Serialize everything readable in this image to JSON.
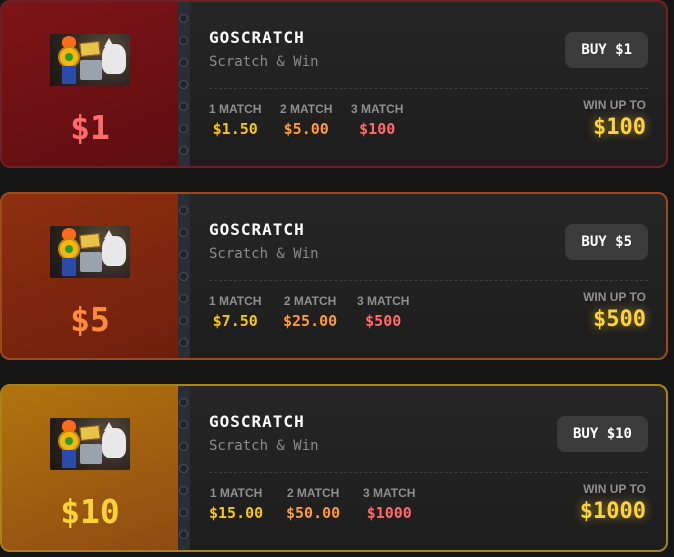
{
  "tickets": [
    {
      "price": "$1",
      "title": "GOSCRATCH",
      "subtitle": "Scratch & Win",
      "buy_label": "BUY $1",
      "matches": [
        {
          "label": "1 MATCH",
          "value": "$1.50"
        },
        {
          "label": "2 MATCH",
          "value": "$5.00"
        },
        {
          "label": "3 MATCH",
          "value": "$100"
        }
      ],
      "win_label": "WIN UP TO",
      "win_value": "$100"
    },
    {
      "price": "$5",
      "title": "GOSCRATCH",
      "subtitle": "Scratch & Win",
      "buy_label": "BUY $5",
      "matches": [
        {
          "label": "1 MATCH",
          "value": "$7.50"
        },
        {
          "label": "2 MATCH",
          "value": "$25.00"
        },
        {
          "label": "3 MATCH",
          "value": "$500"
        }
      ],
      "win_label": "WIN UP TO",
      "win_value": "$500"
    },
    {
      "price": "$10",
      "title": "GOSCRATCH",
      "subtitle": "Scratch & Win",
      "buy_label": "BUY $10",
      "matches": [
        {
          "label": "1 MATCH",
          "value": "$15.00"
        },
        {
          "label": "2 MATCH",
          "value": "$50.00"
        },
        {
          "label": "3 MATCH",
          "value": "$1000"
        }
      ],
      "win_label": "WIN UP TO",
      "win_value": "$1000"
    }
  ],
  "colors": {
    "match_1": "#f5c518",
    "match_2": "#ff9a3c",
    "match_3": "#ff6b6b",
    "win": "#ffd23a",
    "tier_1_accent": "#7d1418",
    "tier_5_accent": "#8e2f10",
    "tier_10_accent": "#b2740d"
  },
  "icons": [
    "ticket-artwork-image"
  ]
}
